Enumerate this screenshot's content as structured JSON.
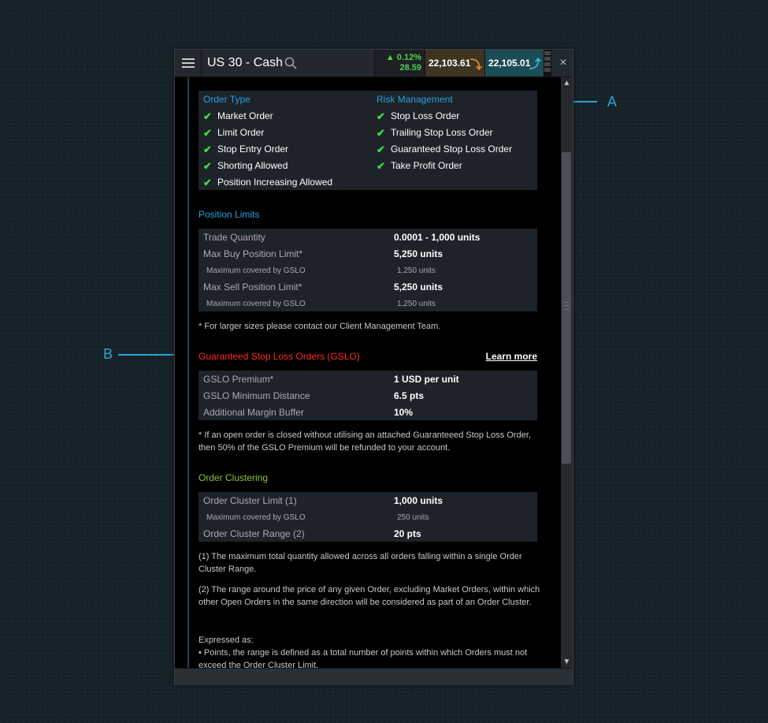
{
  "titlebar": {
    "instrument": "US 30 - Cash",
    "change_pct": "▲ 0.12%",
    "change_pts": "28.59",
    "sell_price": "22,103.61",
    "buy_price": "22,105.01",
    "close_label": "×"
  },
  "order_type": {
    "title": "Order Type",
    "items": [
      "Market Order",
      "Limit Order",
      "Stop Entry Order",
      "Shorting Allowed",
      "Position Increasing Allowed"
    ]
  },
  "risk_management": {
    "title": "Risk Management",
    "items": [
      "Stop Loss Order",
      "Trailing Stop Loss Order",
      "Guaranteed Stop Loss Order",
      "Take Profit Order"
    ]
  },
  "position_limits": {
    "title": "Position Limits",
    "rows": [
      {
        "label": "Trade Quantity",
        "value": "0.0001 - 1,000 units"
      },
      {
        "label": "Max Buy Position Limit*",
        "value": "5,250 units"
      },
      {
        "label": "Maximum covered by GSLO",
        "value": "1,250 units"
      },
      {
        "label": "Max Sell Position Limit*",
        "value": "5,250 units"
      },
      {
        "label": "Maximum covered by GSLO",
        "value": "1,250 units"
      }
    ],
    "note": "* For larger sizes please contact our Client Management Team."
  },
  "gslo": {
    "title": "Guaranteed Stop Loss Orders (GSLO)",
    "learn_more": "Learn more",
    "rows": [
      {
        "label": "GSLO Premium*",
        "value": "1 USD per unit"
      },
      {
        "label": "GSLO Minimum Distance",
        "value": "6.5 pts"
      },
      {
        "label": "Additional Margin Buffer",
        "value": "10%"
      }
    ],
    "note": "* If an open order is closed without utilising an attached Guaranteeed Stop Loss Order, then 50% of the GSLO Premium will be refunded to your account."
  },
  "order_clustering": {
    "title": "Order Clustering",
    "rows": [
      {
        "label": "Order Cluster Limit (1)",
        "value": "1,000 units"
      },
      {
        "label": "Maximum covered by GSLO",
        "value": "250 units"
      },
      {
        "label": "Order Cluster Range (2)",
        "value": "20 pts"
      }
    ],
    "note1": "(1) The maximum total quantity allowed across all orders falling within a single Order Cluster Range.",
    "note2": "(2) The range around the price of any given Order, excluding Market Orders, within which other Open Orders in the same direction will be considered as part of an Order Cluster.",
    "expressed_as": "Expressed as:",
    "bullet": "• Points, the range is defined as a total number of points within which Orders must not exceed the Order Cluster Limit."
  },
  "callouts": {
    "a": "A",
    "b": "B"
  },
  "colors": {
    "accent_blue": "#2a9fdc",
    "gslo_red": "#ff2a2a",
    "cluster_green": "#8fc33a",
    "tick_green": "#3edc3e"
  }
}
